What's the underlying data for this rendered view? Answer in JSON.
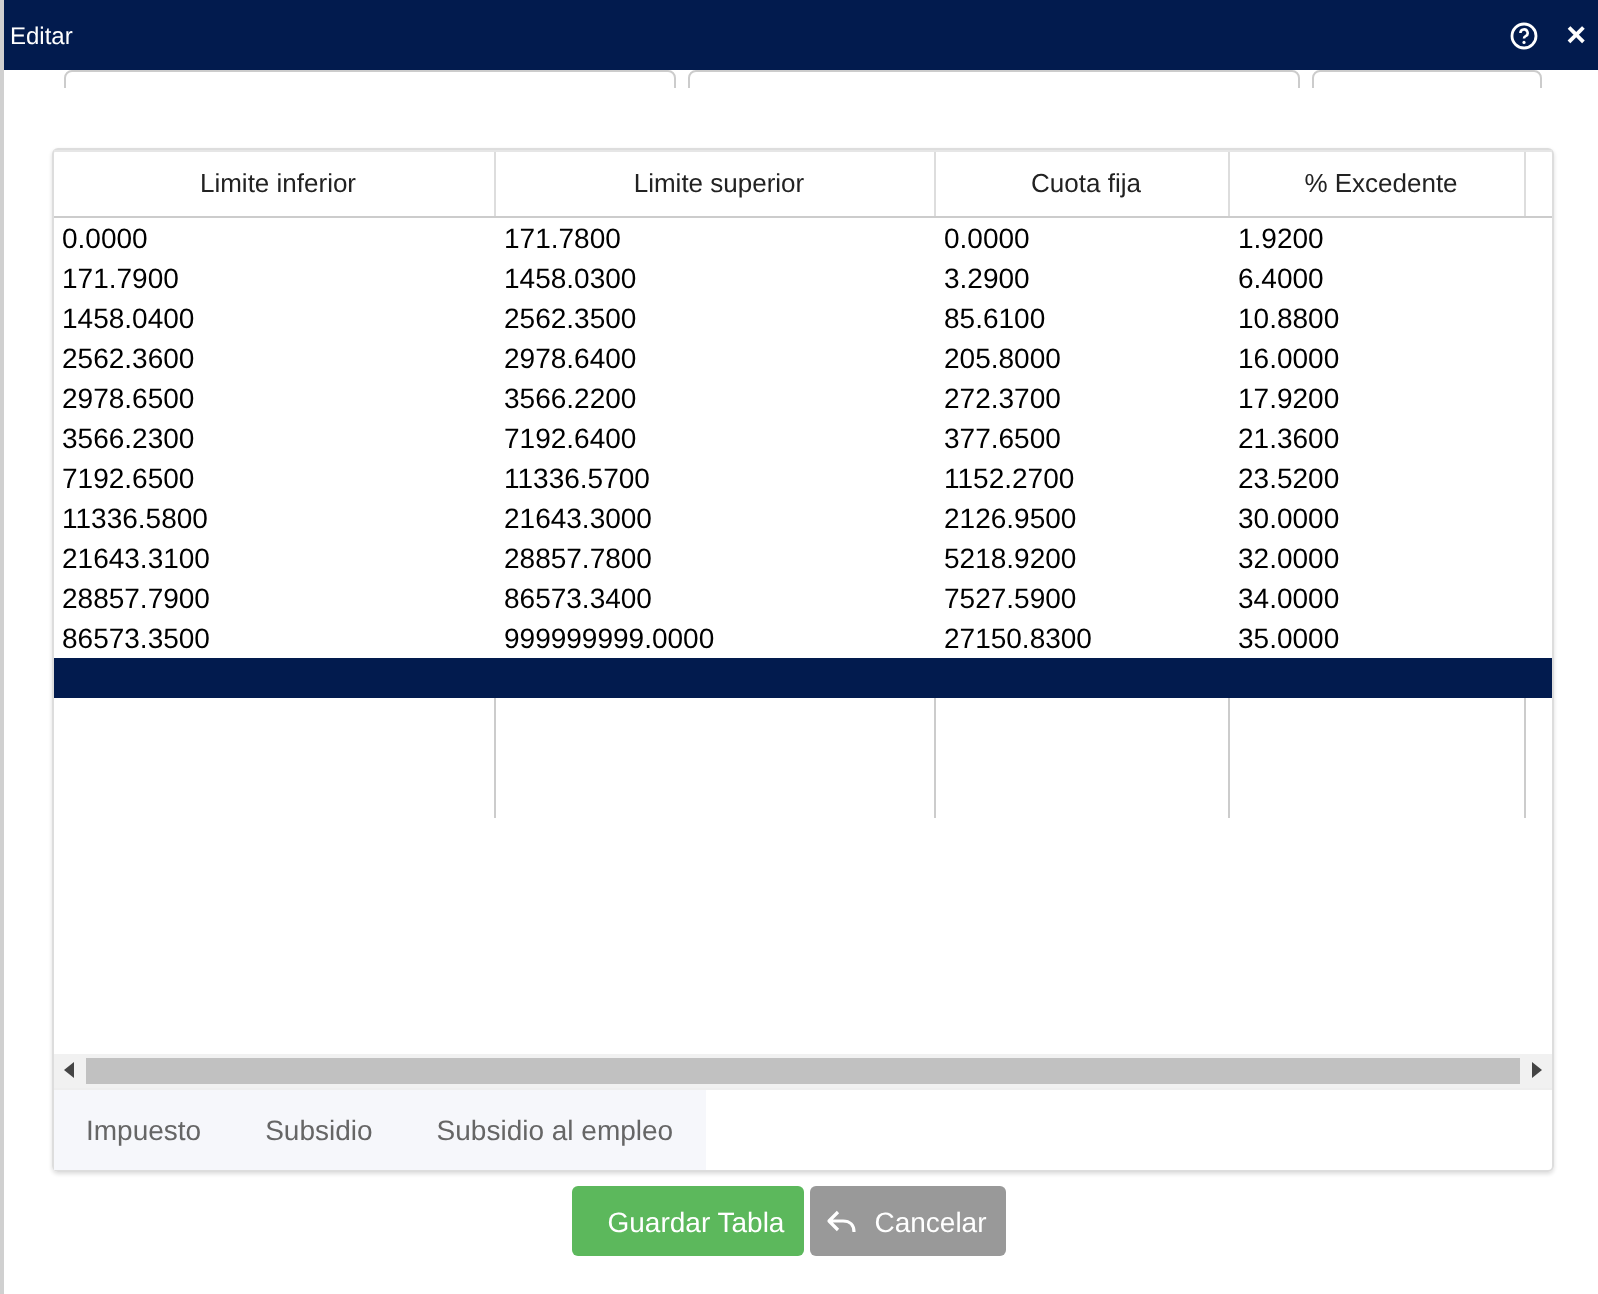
{
  "window": {
    "title": "Editar",
    "help_icon": true,
    "close_icon": "×"
  },
  "top_fields": [
    {
      "kind": "input"
    },
    {
      "kind": "input"
    },
    {
      "kind": "input"
    }
  ],
  "table": {
    "columns": [
      "Limite inferior",
      "Limite superior",
      "Cuota fija",
      "% Excedente"
    ],
    "rows": [
      {
        "cells": [
          "0.0000",
          "171.7800",
          "0.0000",
          "1.9200"
        ],
        "selected": false
      },
      {
        "cells": [
          "171.7900",
          "1458.0300",
          "3.2900",
          "6.4000"
        ],
        "selected": false
      },
      {
        "cells": [
          "1458.0400",
          "2562.3500",
          "85.6100",
          "10.8800"
        ],
        "selected": false
      },
      {
        "cells": [
          "2562.3600",
          "2978.6400",
          "205.8000",
          "16.0000"
        ],
        "selected": false
      },
      {
        "cells": [
          "2978.6500",
          "3566.2200",
          "272.3700",
          "17.9200"
        ],
        "selected": false
      },
      {
        "cells": [
          "3566.2300",
          "7192.6400",
          "377.6500",
          "21.3600"
        ],
        "selected": false
      },
      {
        "cells": [
          "7192.6500",
          "11336.5700",
          "1152.2700",
          "23.5200"
        ],
        "selected": false
      },
      {
        "cells": [
          "11336.5800",
          "21643.3000",
          "2126.9500",
          "30.0000"
        ],
        "selected": false
      },
      {
        "cells": [
          "21643.3100",
          "28857.7800",
          "5218.9200",
          "32.0000"
        ],
        "selected": false
      },
      {
        "cells": [
          "28857.7900",
          "86573.3400",
          "7527.5900",
          "34.0000"
        ],
        "selected": false
      },
      {
        "cells": [
          "86573.3500",
          "999999999.0000",
          "27150.8300",
          "35.0000"
        ],
        "selected": false
      },
      {
        "cells": [],
        "selected": true
      }
    ]
  },
  "tabs": [
    {
      "label": "Impuesto",
      "selected": false
    },
    {
      "label": "Subsidio",
      "selected": false
    },
    {
      "label": "Subsidio al empleo",
      "selected": false
    }
  ],
  "buttons": [
    {
      "label": "Guardar Tabla",
      "kind": "primary"
    },
    {
      "label": "Cancelar",
      "kind": "cancel"
    }
  ]
}
